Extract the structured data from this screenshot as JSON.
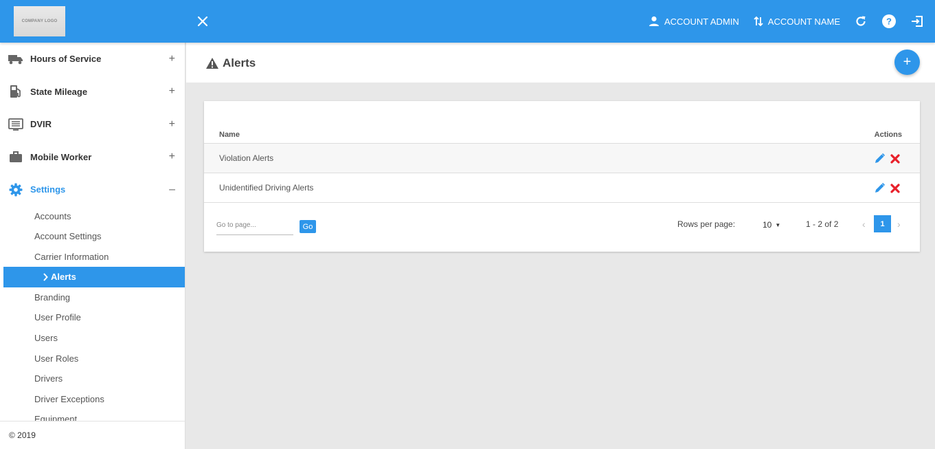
{
  "header": {
    "logo_text": "COMPANY LOGO",
    "account_admin": "ACCOUNT ADMIN",
    "account_name": "ACCOUNT NAME"
  },
  "sidebar": {
    "groups": [
      {
        "label": "Hours of Service",
        "toggle": "+"
      },
      {
        "label": "State Mileage",
        "toggle": "+"
      },
      {
        "label": "DVIR",
        "toggle": "+"
      },
      {
        "label": "Mobile Worker",
        "toggle": "+"
      },
      {
        "label": "Settings",
        "toggle": "–"
      }
    ],
    "settings_items": [
      "Accounts",
      "Account Settings",
      "Carrier Information",
      "Alerts",
      "Branding",
      "User Profile",
      "Users",
      "User Roles",
      "Drivers",
      "Driver Exceptions",
      "Equipment"
    ],
    "footer": "© 2019"
  },
  "page": {
    "title": "Alerts",
    "add_label": "+"
  },
  "table": {
    "columns": [
      "Name",
      "Actions"
    ],
    "rows": [
      "Violation Alerts",
      "Unidentified Driving Alerts"
    ]
  },
  "pagination": {
    "goto_placeholder": "Go to page...",
    "go_label": "Go",
    "rows_per_page_label": "Rows per page:",
    "rows_per_page_value": "10",
    "range": "1 - 2 of 2",
    "current_page": "1",
    "prev": "‹",
    "next": "›"
  },
  "colors": {
    "primary": "#2e96ea",
    "danger": "#e8202a"
  }
}
